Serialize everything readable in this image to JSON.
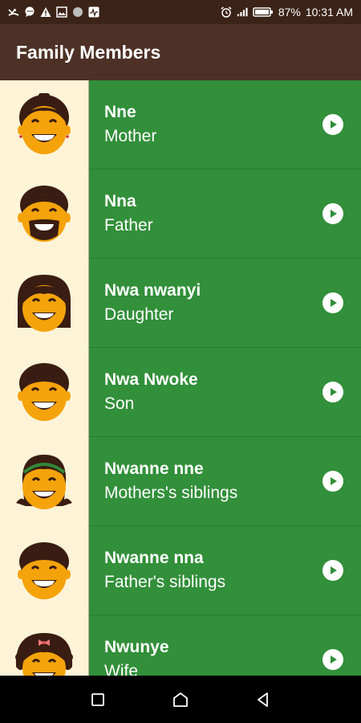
{
  "status_bar": {
    "battery": "87%",
    "time": "10:31 AM",
    "left_icons": [
      "missed-call-icon",
      "chat-icon",
      "warning-icon",
      "image-icon",
      "circle-icon",
      "activity-icon"
    ],
    "right_icons": [
      "alarm-icon",
      "signal-icon",
      "battery-icon"
    ]
  },
  "app_bar": {
    "title": "Family Members"
  },
  "members": [
    {
      "igbo": "Nne",
      "english": "Mother",
      "avatar": "mother-avatar"
    },
    {
      "igbo": "Nna",
      "english": "Father",
      "avatar": "father-avatar"
    },
    {
      "igbo": "Nwa nwanyi",
      "english": "Daughter",
      "avatar": "daughter-avatar"
    },
    {
      "igbo": "Nwa Nwoke",
      "english": "Son",
      "avatar": "son-avatar"
    },
    {
      "igbo": "Nwanne nne",
      "english": "Mothers's siblings",
      "avatar": "mothers-siblings-avatar"
    },
    {
      "igbo": "Nwanne nna",
      "english": "Father's siblings",
      "avatar": "fathers-siblings-avatar"
    },
    {
      "igbo": "Nwunye",
      "english": "Wife",
      "avatar": "wife-avatar"
    }
  ],
  "nav_bar": {
    "icons": [
      "recents-icon",
      "home-icon",
      "back-icon"
    ]
  },
  "colors": {
    "status_bar": "#3b2318",
    "app_bar": "#4d3126",
    "row_green": "#328f3a",
    "avatar_bg": "#fdf3d7",
    "face": "#f4a30b",
    "hair": "#3a1d12"
  }
}
